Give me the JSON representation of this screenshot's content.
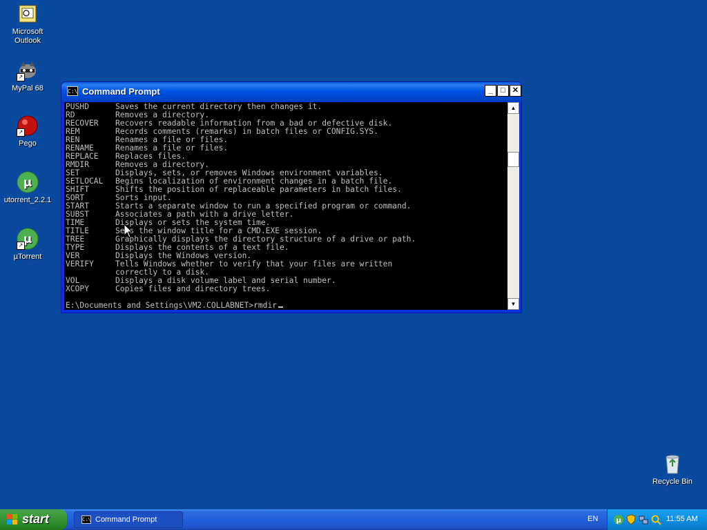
{
  "desktop": {
    "icons": [
      {
        "name": "outlook",
        "label": "Microsoft\nOutlook",
        "line1": "Microsoft",
        "line2": "Outlook"
      },
      {
        "name": "mypal",
        "label": "MyPal 68"
      },
      {
        "name": "pego",
        "label": "Pego"
      },
      {
        "name": "utorrent221",
        "label": "utorrent_2.2.1"
      },
      {
        "name": "utorrent",
        "label": "µTorrent"
      },
      {
        "name": "recycle",
        "label": "Recycle Bin"
      }
    ]
  },
  "window": {
    "title": "Command Prompt",
    "icon_text": "C:\\",
    "minimize": "_",
    "maximize": "□",
    "close": "✕"
  },
  "console": {
    "lines": [
      {
        "cmd": "PUSHD",
        "desc": "Saves the current directory then changes it."
      },
      {
        "cmd": "RD",
        "desc": "Removes a directory."
      },
      {
        "cmd": "RECOVER",
        "desc": "Recovers readable information from a bad or defective disk."
      },
      {
        "cmd": "REM",
        "desc": "Records comments (remarks) in batch files or CONFIG.SYS."
      },
      {
        "cmd": "REN",
        "desc": "Renames a file or files."
      },
      {
        "cmd": "RENAME",
        "desc": "Renames a file or files."
      },
      {
        "cmd": "REPLACE",
        "desc": "Replaces files."
      },
      {
        "cmd": "RMDIR",
        "desc": "Removes a directory."
      },
      {
        "cmd": "SET",
        "desc": "Displays, sets, or removes Windows environment variables."
      },
      {
        "cmd": "SETLOCAL",
        "desc": "Begins localization of environment changes in a batch file."
      },
      {
        "cmd": "SHIFT",
        "desc": "Shifts the position of replaceable parameters in batch files."
      },
      {
        "cmd": "SORT",
        "desc": "Sorts input."
      },
      {
        "cmd": "START",
        "desc": "Starts a separate window to run a specified program or command."
      },
      {
        "cmd": "SUBST",
        "desc": "Associates a path with a drive letter."
      },
      {
        "cmd": "TIME",
        "desc": "Displays or sets the system time."
      },
      {
        "cmd": "TITLE",
        "desc": "Sets the window title for a CMD.EXE session."
      },
      {
        "cmd": "TREE",
        "desc": "Graphically displays the directory structure of a drive or path."
      },
      {
        "cmd": "TYPE",
        "desc": "Displays the contents of a text file."
      },
      {
        "cmd": "VER",
        "desc": "Displays the Windows version."
      },
      {
        "cmd": "VERIFY",
        "desc": "Tells Windows whether to verify that your files are written"
      },
      {
        "cmd": "",
        "desc": "correctly to a disk."
      },
      {
        "cmd": "VOL",
        "desc": "Displays a disk volume label and serial number."
      },
      {
        "cmd": "XCOPY",
        "desc": "Copies files and directory trees."
      }
    ],
    "prompt": "E:\\Documents and Settings\\VM2.COLLABNET>rmdir"
  },
  "taskbar": {
    "start_label": "start",
    "task_label": "Command Prompt",
    "language": "EN",
    "clock": "11:55 AM"
  },
  "colors": {
    "desktop": "#0a4a9e",
    "console_bg": "#000000",
    "console_text": "#c0c0c0",
    "title_bar": "#0054e3"
  }
}
